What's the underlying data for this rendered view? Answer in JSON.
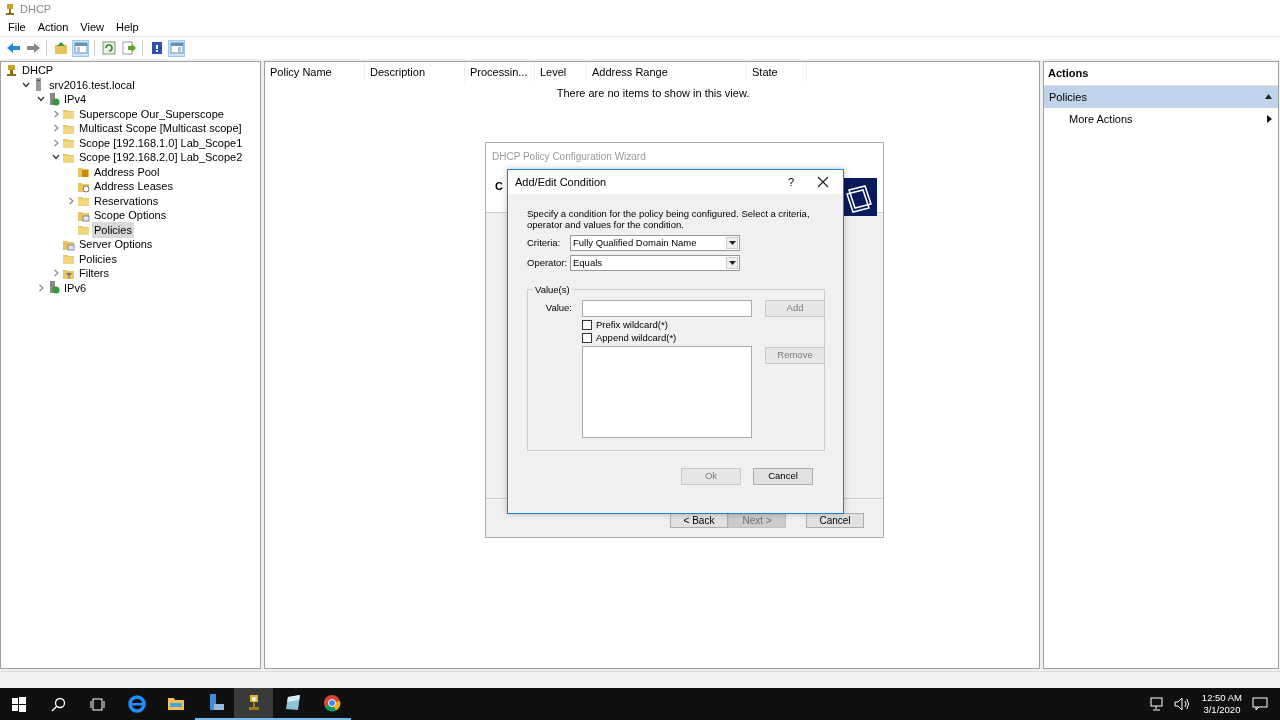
{
  "window": {
    "title": "DHCP"
  },
  "menu": [
    "File",
    "Action",
    "View",
    "Help"
  ],
  "toolbar": [
    {
      "kind": "back",
      "pressed": false
    },
    {
      "kind": "forward",
      "pressed": false
    },
    {
      "kind": "sep"
    },
    {
      "kind": "up",
      "pressed": false
    },
    {
      "kind": "tree",
      "pressed": true
    },
    {
      "kind": "sep"
    },
    {
      "kind": "refresh",
      "pressed": false
    },
    {
      "kind": "export",
      "pressed": false
    },
    {
      "kind": "sep"
    },
    {
      "kind": "help",
      "pressed": false
    },
    {
      "kind": "pane",
      "pressed": true
    }
  ],
  "tree": [
    {
      "label": "DHCP",
      "kind": "dhcp",
      "selected": false,
      "children": [
        {
          "label": "srv2016.test.local",
          "kind": "server",
          "expandable": true,
          "expanded": true,
          "selected": false,
          "children": [
            {
              "label": "IPv4",
              "kind": "ip",
              "expandable": true,
              "expanded": true,
              "selected": false,
              "children": [
                {
                  "label": "Superscope Our_Superscope",
                  "kind": "folder",
                  "expandable": true,
                  "expanded": false,
                  "selected": false
                },
                {
                  "label": "Multicast Scope [Multicast scope]",
                  "kind": "folder",
                  "expandable": true,
                  "expanded": false,
                  "selected": false
                },
                {
                  "label": "Scope [192.168.1.0] Lab_Scope1",
                  "kind": "folder",
                  "expandable": true,
                  "expanded": false,
                  "selected": false
                },
                {
                  "label": "Scope [192.168.2.0] Lab_Scope2",
                  "kind": "folder",
                  "expandable": true,
                  "expanded": true,
                  "selected": false,
                  "children": [
                    {
                      "label": "Address Pool",
                      "kind": "pool",
                      "expandable": false,
                      "expanded": false,
                      "selected": false
                    },
                    {
                      "label": "Address Leases",
                      "kind": "leases",
                      "expandable": false,
                      "expanded": false,
                      "selected": false
                    },
                    {
                      "label": "Reservations",
                      "kind": "folder",
                      "expandable": true,
                      "expanded": false,
                      "selected": false
                    },
                    {
                      "label": "Scope Options",
                      "kind": "options",
                      "expandable": false,
                      "expanded": false,
                      "selected": false
                    },
                    {
                      "label": "Policies",
                      "kind": "folder",
                      "expandable": false,
                      "expanded": false,
                      "selected": true
                    }
                  ]
                },
                {
                  "label": "Server Options",
                  "kind": "options",
                  "expandable": false,
                  "expanded": false,
                  "selected": false
                },
                {
                  "label": "Policies",
                  "kind": "folder",
                  "expandable": false,
                  "expanded": false,
                  "selected": false
                },
                {
                  "label": "Filters",
                  "kind": "filter",
                  "expandable": true,
                  "expanded": false,
                  "selected": false
                }
              ]
            },
            {
              "label": "IPv6",
              "kind": "ip",
              "expandable": true,
              "expanded": false,
              "selected": false
            }
          ]
        }
      ]
    }
  ],
  "list": {
    "columns": [
      "Policy Name",
      "Description",
      "Processin...",
      "Level",
      "Address Range",
      "State"
    ],
    "empty_message": "There are no items to show in this view."
  },
  "wizard": {
    "title": "DHCP Policy Configuration Wizard",
    "heading": "C",
    "buttons": [
      {
        "label": "< Back",
        "disabled": false
      },
      {
        "label": "Next >",
        "disabled": true
      },
      {
        "label": "Cancel",
        "disabled": false
      }
    ]
  },
  "dialog": {
    "title": "Add/Edit Condition",
    "help": "?",
    "instructions": "Specify a condition for the policy being configured. Select a criteria, operator and values for the condition.",
    "criteria": {
      "label": "Criteria:",
      "value": "Fully Qualified Domain Name"
    },
    "operator": {
      "label": "Operator:",
      "value": "Equals"
    },
    "group_title": "Value(s)",
    "value_label": "Value:",
    "add": {
      "label": "Add",
      "disabled": true
    },
    "remove": {
      "label": "Remove",
      "disabled": true
    },
    "checkboxes": [
      {
        "label": "Prefix wildcard(*)",
        "checked": false
      },
      {
        "label": "Append wildcard(*)",
        "checked": false
      }
    ],
    "buttons": [
      {
        "label": "Ok",
        "disabled": true
      },
      {
        "label": "Cancel",
        "disabled": false
      }
    ]
  },
  "actions": {
    "title": "Actions",
    "sections": [
      {
        "label": "Policies",
        "expanded": true,
        "items": [
          {
            "label": "More Actions",
            "submenu": true
          }
        ]
      }
    ]
  },
  "taskbar": [
    {
      "kind": "start",
      "open": false,
      "active": false
    },
    {
      "kind": "search",
      "open": false,
      "active": false
    },
    {
      "kind": "taskview",
      "open": false,
      "active": false
    },
    {
      "kind": "ie",
      "open": false,
      "active": false
    },
    {
      "kind": "explorer",
      "open": false,
      "active": false
    },
    {
      "kind": "servermgr",
      "open": true,
      "active": false
    },
    {
      "kind": "dhcp",
      "open": true,
      "active": true
    },
    {
      "kind": "app",
      "open": true,
      "active": false
    },
    {
      "kind": "chrome",
      "open": true,
      "active": false
    }
  ],
  "tray": {
    "time": "12:50 AM",
    "date": "3/1/2020"
  }
}
